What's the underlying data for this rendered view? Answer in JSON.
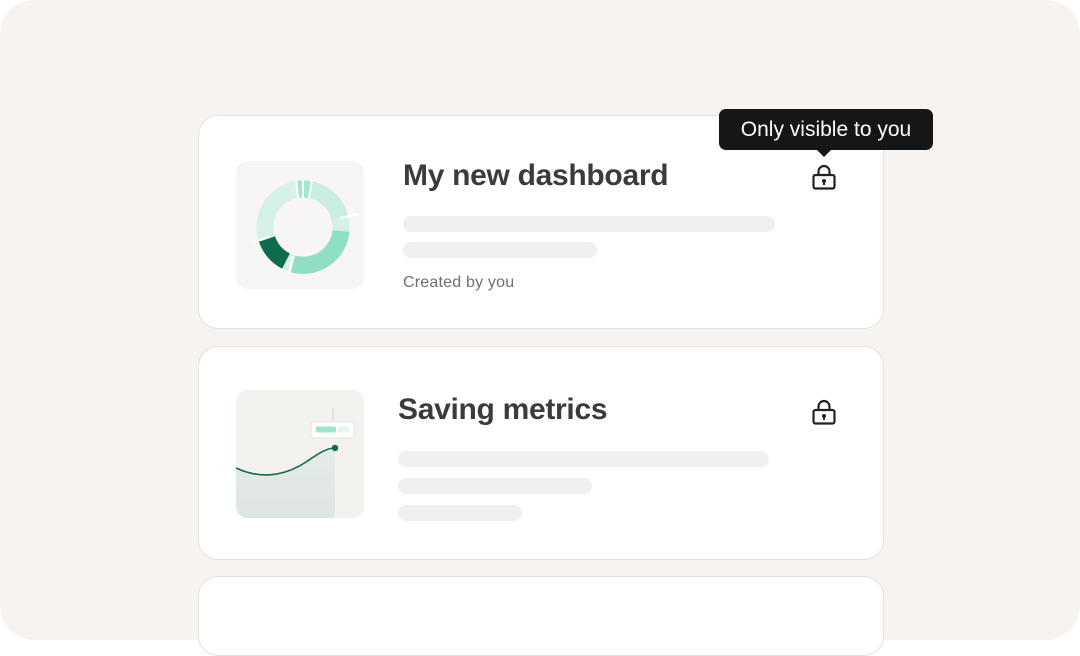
{
  "tooltip": {
    "text": "Only visible to you"
  },
  "dashboards": [
    {
      "title": "My new dashboard",
      "meta": "Created by you",
      "thumbnail_icon": "donut-chart-icon",
      "privacy_icon": "lock-icon"
    },
    {
      "title": "Saving metrics",
      "meta": "",
      "thumbnail_icon": "line-chart-icon",
      "privacy_icon": "lock-icon"
    }
  ],
  "colors": {
    "background": "#f6f3f1",
    "card": "#ffffff",
    "accent_dark": "#0d6b4e",
    "accent_light": "#8fe0c3",
    "tooltip_bg": "#161616"
  }
}
